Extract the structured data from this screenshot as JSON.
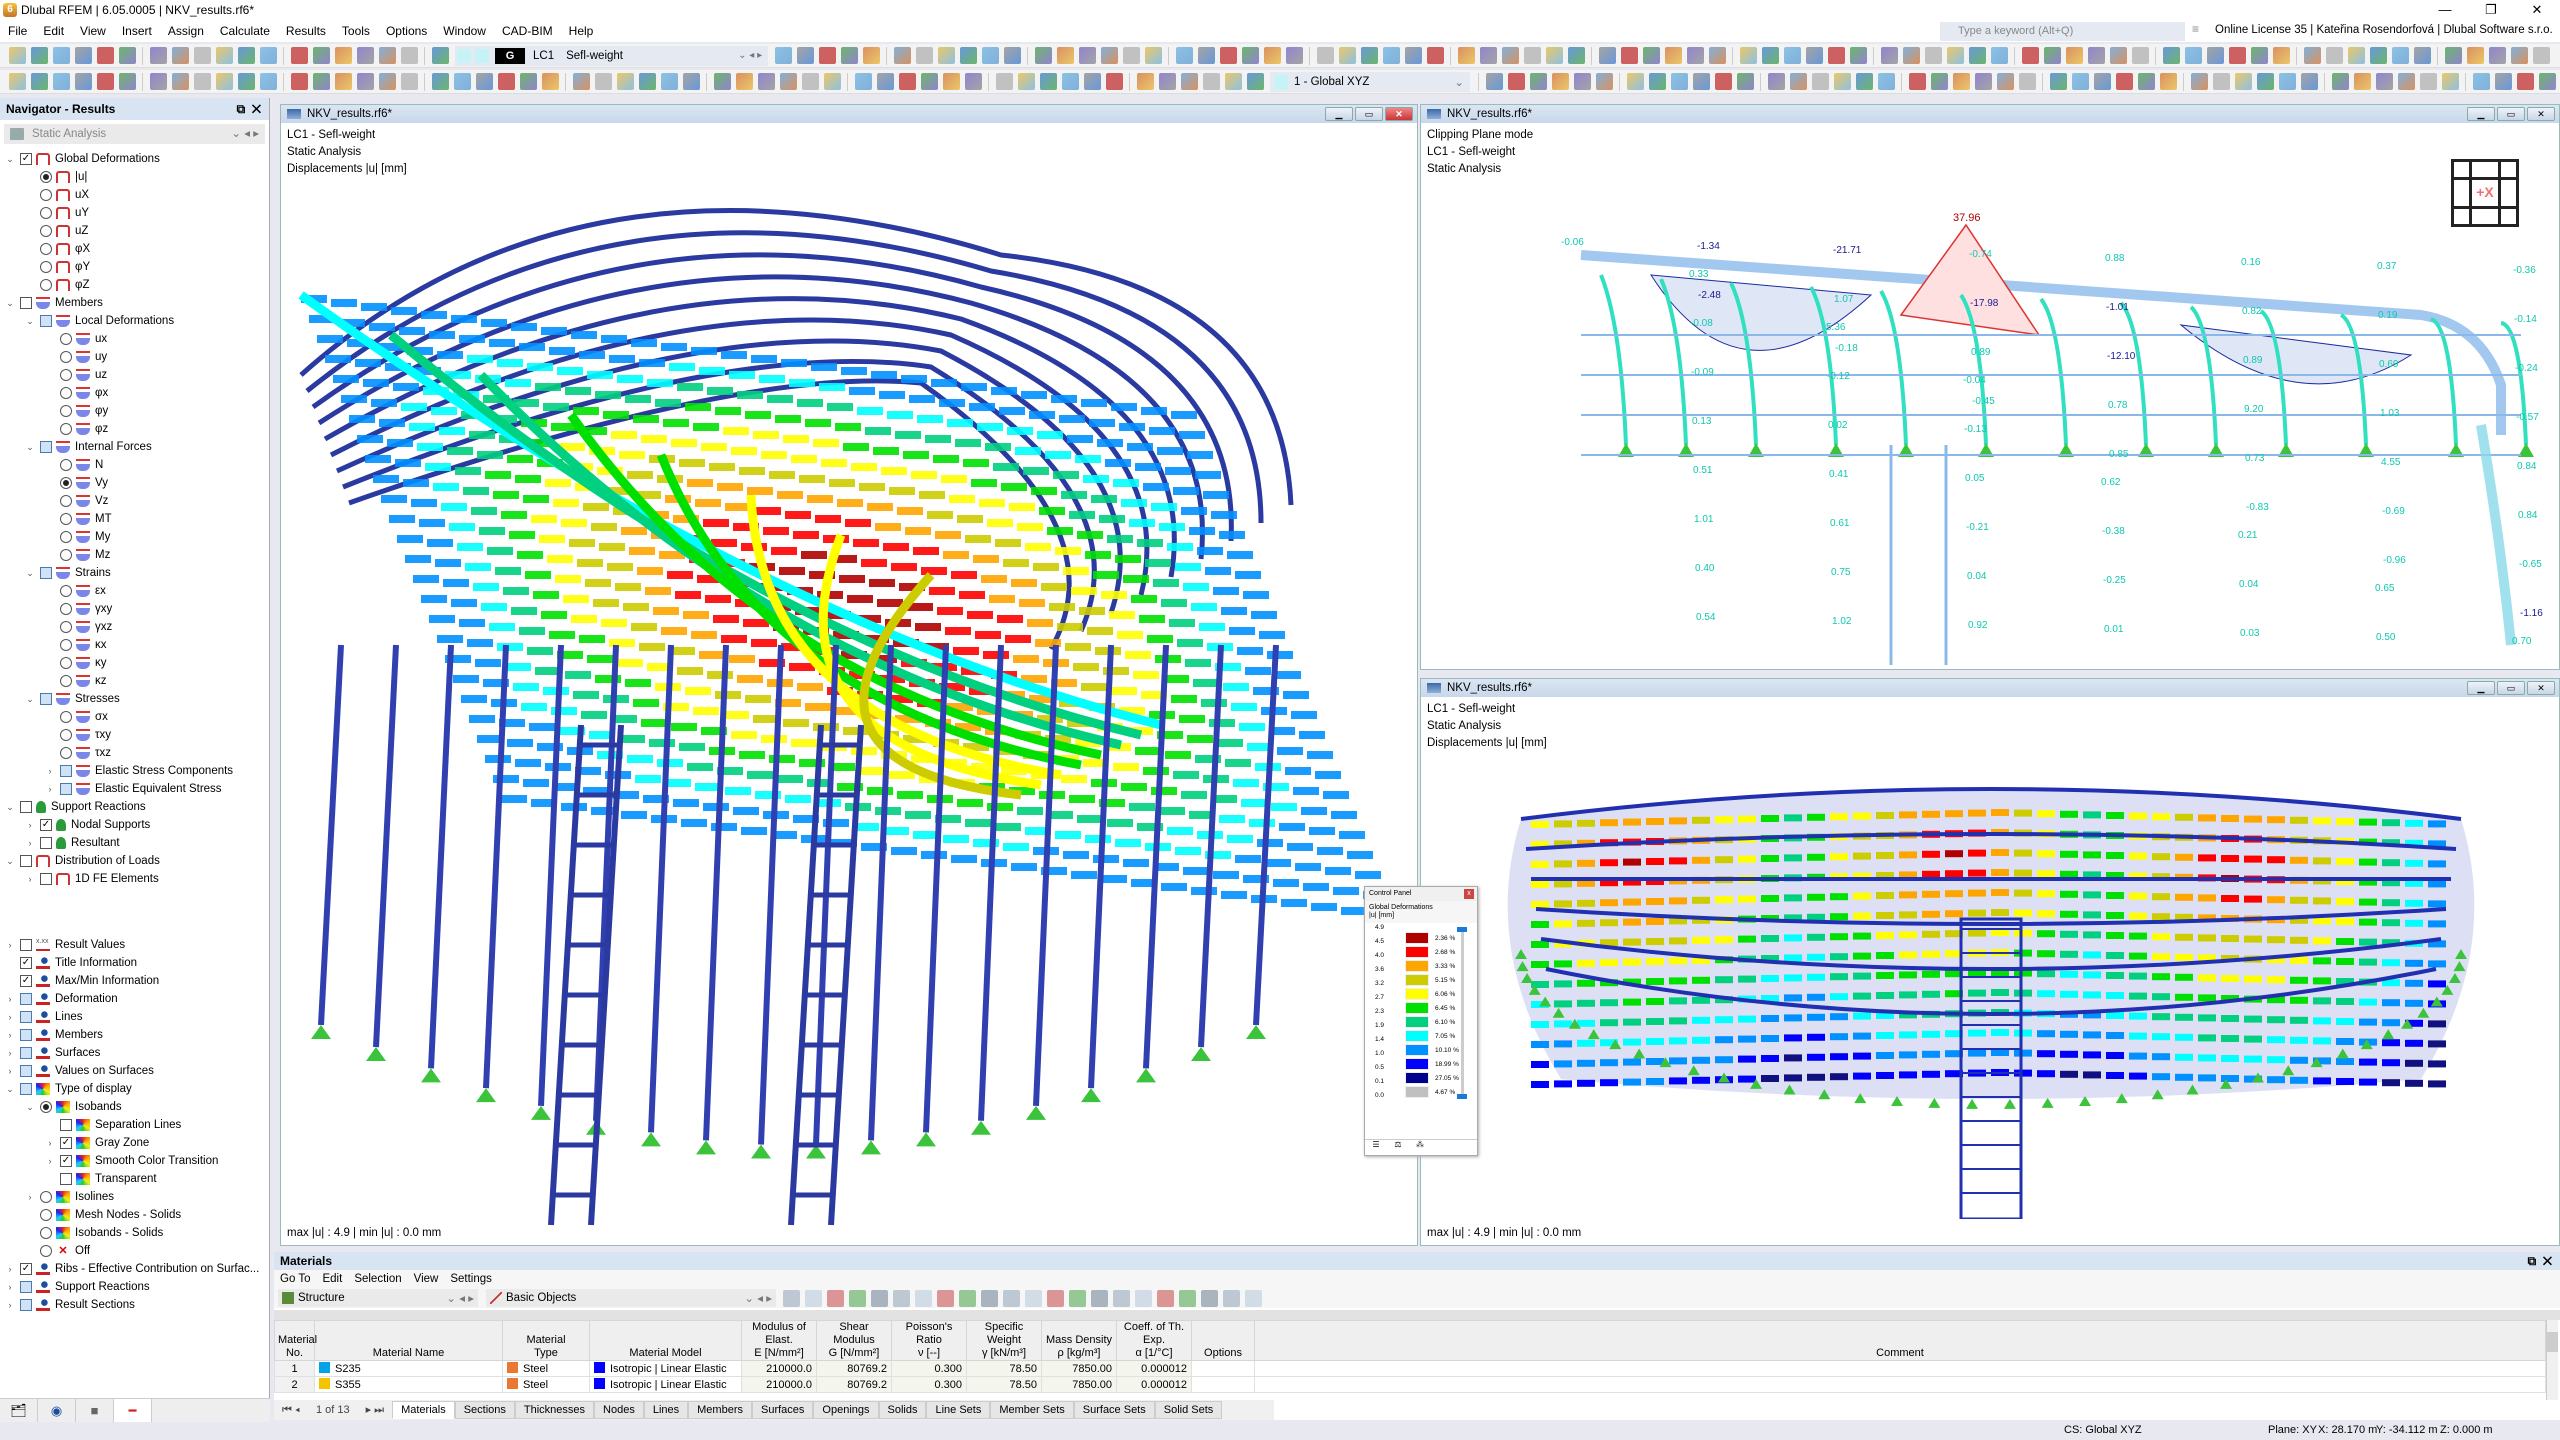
{
  "app": {
    "title": "Dlubal RFEM | 6.05.0005 | NKV_results.rf6*"
  },
  "menu": [
    "File",
    "Edit",
    "View",
    "Insert",
    "Assign",
    "Calculate",
    "Results",
    "Tools",
    "Options",
    "Window",
    "CAD-BIM",
    "Help"
  ],
  "search": {
    "placeholder": "Type a keyword (Alt+Q)"
  },
  "license": "Online License 35 | Kateřina Rosendorfová | Dlubal Software s.r.o.",
  "toolbar": {
    "loadcase_badge": "G",
    "loadcase_id": "LC1",
    "loadcase_name": "Sefl-weight",
    "coord_system": "1 - Global XYZ"
  },
  "navigator": {
    "title": "Navigator - Results",
    "analysis": "Static Analysis",
    "items": [
      {
        "label": "Global Deformations",
        "level": 0,
        "type": "cb",
        "state": "checked",
        "icon": "gd",
        "exp": "open"
      },
      {
        "label": "|u|",
        "level": 1,
        "type": "rd",
        "state": "on",
        "icon": "gd"
      },
      {
        "label": "uX",
        "level": 1,
        "type": "rd",
        "state": "off",
        "icon": "gd"
      },
      {
        "label": "uY",
        "level": 1,
        "type": "rd",
        "state": "off",
        "icon": "gd"
      },
      {
        "label": "uZ",
        "level": 1,
        "type": "rd",
        "state": "off",
        "icon": "gd"
      },
      {
        "label": "φX",
        "level": 1,
        "type": "rd",
        "state": "off",
        "icon": "gd"
      },
      {
        "label": "φY",
        "level": 1,
        "type": "rd",
        "state": "off",
        "icon": "gd"
      },
      {
        "label": "φZ",
        "level": 1,
        "type": "rd",
        "state": "off",
        "icon": "gd"
      },
      {
        "label": "Members",
        "level": 0,
        "type": "cb",
        "state": "unchecked",
        "icon": "mb",
        "exp": "open"
      },
      {
        "label": "Local Deformations",
        "level": 1,
        "type": "cb",
        "state": "partial",
        "icon": "mb",
        "exp": "open"
      },
      {
        "label": "ux",
        "level": 2,
        "type": "rd",
        "state": "off",
        "icon": "mb"
      },
      {
        "label": "uy",
        "level": 2,
        "type": "rd",
        "state": "off",
        "icon": "mb"
      },
      {
        "label": "uz",
        "level": 2,
        "type": "rd",
        "state": "off",
        "icon": "mb"
      },
      {
        "label": "φx",
        "level": 2,
        "type": "rd",
        "state": "off",
        "icon": "mb"
      },
      {
        "label": "φy",
        "level": 2,
        "type": "rd",
        "state": "off",
        "icon": "mb"
      },
      {
        "label": "φz",
        "level": 2,
        "type": "rd",
        "state": "off",
        "icon": "mb"
      },
      {
        "label": "Internal Forces",
        "level": 1,
        "type": "cb",
        "state": "partial",
        "icon": "mb",
        "exp": "open"
      },
      {
        "label": "N",
        "level": 2,
        "type": "rd",
        "state": "off",
        "icon": "mb"
      },
      {
        "label": "Vy",
        "level": 2,
        "type": "rd",
        "state": "on",
        "icon": "mb"
      },
      {
        "label": "Vz",
        "level": 2,
        "type": "rd",
        "state": "off",
        "icon": "mb"
      },
      {
        "label": "MT",
        "level": 2,
        "type": "rd",
        "state": "off",
        "icon": "mb"
      },
      {
        "label": "My",
        "level": 2,
        "type": "rd",
        "state": "off",
        "icon": "mb"
      },
      {
        "label": "Mz",
        "level": 2,
        "type": "rd",
        "state": "off",
        "icon": "mb"
      },
      {
        "label": "Strains",
        "level": 1,
        "type": "cb",
        "state": "partial",
        "icon": "mb",
        "exp": "open"
      },
      {
        "label": "εx",
        "level": 2,
        "type": "rd",
        "state": "off",
        "icon": "mb"
      },
      {
        "label": "γxy",
        "level": 2,
        "type": "rd",
        "state": "off",
        "icon": "mb"
      },
      {
        "label": "γxz",
        "level": 2,
        "type": "rd",
        "state": "off",
        "icon": "mb"
      },
      {
        "label": "κx",
        "level": 2,
        "type": "rd",
        "state": "off",
        "icon": "mb"
      },
      {
        "label": "κy",
        "level": 2,
        "type": "rd",
        "state": "off",
        "icon": "mb"
      },
      {
        "label": "κz",
        "level": 2,
        "type": "rd",
        "state": "off",
        "icon": "mb"
      },
      {
        "label": "Stresses",
        "level": 1,
        "type": "cb",
        "state": "partial",
        "icon": "mb",
        "exp": "open"
      },
      {
        "label": "σx",
        "level": 2,
        "type": "rd",
        "state": "off",
        "icon": "mb"
      },
      {
        "label": "τxy",
        "level": 2,
        "type": "rd",
        "state": "off",
        "icon": "mb"
      },
      {
        "label": "τxz",
        "level": 2,
        "type": "rd",
        "state": "off",
        "icon": "mb"
      },
      {
        "label": "Elastic Stress Components",
        "level": 2,
        "type": "cb",
        "state": "partial",
        "icon": "mb",
        "exp": "closed"
      },
      {
        "label": "Elastic Equivalent Stress",
        "level": 2,
        "type": "cb",
        "state": "partial",
        "icon": "mb",
        "exp": "closed"
      },
      {
        "label": "Support Reactions",
        "level": 0,
        "type": "cb",
        "state": "unchecked",
        "icon": "sr",
        "exp": "open"
      },
      {
        "label": "Nodal Supports",
        "level": 1,
        "type": "cb",
        "state": "checked",
        "icon": "sr",
        "exp": "closed"
      },
      {
        "label": "Resultant",
        "level": 1,
        "type": "cb",
        "state": "unchecked",
        "icon": "sr",
        "exp": "closed"
      },
      {
        "label": "Distribution of Loads",
        "level": 0,
        "type": "cb",
        "state": "unchecked",
        "icon": "gd",
        "exp": "open"
      },
      {
        "label": "1D FE Elements",
        "level": 1,
        "type": "cb",
        "state": "unchecked",
        "icon": "gd",
        "exp": "closed"
      }
    ],
    "display_items": [
      {
        "label": "Result Values",
        "level": 0,
        "type": "cb",
        "state": "unchecked",
        "icon": "rv",
        "exp": "closed"
      },
      {
        "label": "Title Information",
        "level": 0,
        "type": "cb",
        "state": "checked",
        "icon": "ey"
      },
      {
        "label": "Max/Min Information",
        "level": 0,
        "type": "cb",
        "state": "checked",
        "icon": "ey"
      },
      {
        "label": "Deformation",
        "level": 0,
        "type": "cb",
        "state": "partial",
        "icon": "ey",
        "exp": "closed"
      },
      {
        "label": "Lines",
        "level": 0,
        "type": "cb",
        "state": "partial",
        "icon": "ey",
        "exp": "closed"
      },
      {
        "label": "Members",
        "level": 0,
        "type": "cb",
        "state": "partial",
        "icon": "ey",
        "exp": "closed"
      },
      {
        "label": "Surfaces",
        "level": 0,
        "type": "cb",
        "state": "partial",
        "icon": "ey",
        "exp": "closed"
      },
      {
        "label": "Values on Surfaces",
        "level": 0,
        "type": "cb",
        "state": "partial",
        "icon": "ey",
        "exp": "closed"
      },
      {
        "label": "Type of display",
        "level": 0,
        "type": "cb",
        "state": "partial",
        "icon": "iso",
        "exp": "open"
      },
      {
        "label": "Isobands",
        "level": 1,
        "type": "rd",
        "state": "on",
        "icon": "iso",
        "exp": "open"
      },
      {
        "label": "Separation Lines",
        "level": 2,
        "type": "cb",
        "state": "unchecked",
        "icon": "iso"
      },
      {
        "label": "Gray Zone",
        "level": 2,
        "type": "cb",
        "state": "checked",
        "icon": "iso",
        "exp": "closed"
      },
      {
        "label": "Smooth Color Transition",
        "level": 2,
        "type": "cb",
        "state": "checked",
        "icon": "iso",
        "exp": "closed"
      },
      {
        "label": "Transparent",
        "level": 2,
        "type": "cb",
        "state": "unchecked",
        "icon": "iso"
      },
      {
        "label": "Isolines",
        "level": 1,
        "type": "rd",
        "state": "off",
        "icon": "iso",
        "exp": "closed"
      },
      {
        "label": "Mesh Nodes - Solids",
        "level": 1,
        "type": "rd",
        "state": "off",
        "icon": "iso"
      },
      {
        "label": "Isobands - Solids",
        "level": 1,
        "type": "rd",
        "state": "off",
        "icon": "iso"
      },
      {
        "label": "Off",
        "level": 1,
        "type": "rd",
        "state": "off",
        "icon": "off"
      },
      {
        "label": "Ribs - Effective Contribution on Surfac...",
        "level": 0,
        "type": "cb",
        "state": "checked",
        "icon": "ey",
        "exp": "closed"
      },
      {
        "label": "Support Reactions",
        "level": 0,
        "type": "cb",
        "state": "partial",
        "icon": "ey",
        "exp": "closed"
      },
      {
        "label": "Result Sections",
        "level": 0,
        "type": "cb",
        "state": "partial",
        "icon": "ey",
        "exp": "closed"
      }
    ]
  },
  "viewports": {
    "main": {
      "title": "NKV_results.rf6*",
      "lines": [
        "LC1 - Sefl-weight",
        "Static Analysis",
        "Displacements |u| [mm]"
      ],
      "maxmin": "max |u| : 4.9 | min |u| : 0.0 mm"
    },
    "top_right": {
      "title": "NKV_results.rf6*",
      "lines": [
        "Clipping Plane mode",
        "LC1 - Sefl-weight",
        "Static Analysis"
      ],
      "peak_value": "37.96",
      "view_cube_label": "+X",
      "labels": [
        "-0.06",
        "-2.48",
        "-0.18",
        "-0.45",
        "0.85",
        "-0.83",
        "-0.96",
        "-1.16",
        "-1.34",
        "1.07",
        "0.89",
        "0.78",
        "0.73",
        "-0.69",
        "-0.65",
        "0.54",
        "-21.71",
        "-17.98",
        "-12.10",
        "9.20",
        "4.55",
        "0.84",
        "0.40",
        "1.02",
        "-0.74",
        "-1.01",
        "0.89",
        "1.03",
        "0.84",
        "1.01",
        "0.75",
        "0.92",
        "0.88",
        "0.82",
        "0.69",
        "-0.57",
        "0.51",
        "0.61",
        "0.04",
        "0.01",
        "0.16",
        "0.19",
        "-0.24",
        "0.13",
        "0.41",
        "-0.21",
        "-0.25",
        "0.03",
        "0.37",
        "-0.14",
        "-0.09",
        "0.02",
        "0.05",
        "-0.38",
        "0.04",
        "0.50",
        "-0.36",
        "-0.08",
        "-0.12",
        "-0.13",
        "0.62",
        "0.21",
        "0.65",
        "0.70",
        "0.33",
        "5.36",
        "-0.04"
      ]
    },
    "bottom_right": {
      "title": "NKV_results.rf6*",
      "lines": [
        "LC1 - Sefl-weight",
        "Static Analysis",
        "Displacements |u| [mm]"
      ],
      "maxmin": "max |u| : 4.9 | min |u| : 0.0 mm"
    }
  },
  "control_panel": {
    "title": "Control Panel",
    "subtitle": "Global Deformations",
    "unit": "|u| [mm]",
    "values": [
      "4.9",
      "4.5",
      "4.0",
      "3.6",
      "3.2",
      "2.7",
      "2.3",
      "1.9",
      "1.4",
      "1.0",
      "0.5",
      "0.1",
      "0.0"
    ],
    "bands": [
      {
        "color": "#b00000",
        "pct": "2.36 %"
      },
      {
        "color": "#ff0000",
        "pct": "2.68 %"
      },
      {
        "color": "#ffa500",
        "pct": "3.33 %"
      },
      {
        "color": "#cccc00",
        "pct": "5.15 %"
      },
      {
        "color": "#ffff00",
        "pct": "6.06 %"
      },
      {
        "color": "#00e000",
        "pct": "6.45 %"
      },
      {
        "color": "#00d080",
        "pct": "6.10 %"
      },
      {
        "color": "#00ffff",
        "pct": "7.05 %"
      },
      {
        "color": "#0090ff",
        "pct": "10.10 %"
      },
      {
        "color": "#0000ff",
        "pct": "18.99 %"
      },
      {
        "color": "#000090",
        "pct": "27.05 %"
      },
      {
        "color": "#c0c0c0",
        "pct": "4.67 %"
      }
    ]
  },
  "materials_panel": {
    "title": "Materials",
    "menu": [
      "Go To",
      "Edit",
      "Selection",
      "View",
      "Settings"
    ],
    "filter1": "Structure",
    "filter2": "Basic Objects",
    "headers": [
      [
        "Material",
        "No."
      ],
      [
        "",
        "Material Name"
      ],
      [
        "Material",
        "Type"
      ],
      [
        "",
        "Material Model"
      ],
      [
        "Modulus of Elast.",
        "E [N/mm²]"
      ],
      [
        "Shear Modulus",
        "G [N/mm²]"
      ],
      [
        "Poisson's Ratio",
        "ν [--]"
      ],
      [
        "Specific Weight",
        "γ [kN/m³]"
      ],
      [
        "Mass Density",
        "ρ [kg/m³]"
      ],
      [
        "Coeff. of Th. Exp.",
        "α [1/°C]"
      ],
      [
        "",
        "Options"
      ],
      [
        "",
        "Comment"
      ]
    ],
    "rows": [
      {
        "no": "1",
        "name": "S235",
        "name_color": "#00a2e8",
        "type": "Steel",
        "type_color": "#e87833",
        "model": "Isotropic | Linear Elastic",
        "model_color": "#0000ff",
        "E": "210000.0",
        "G": "80769.2",
        "nu": "0.300",
        "gamma": "78.50",
        "rho": "7850.00",
        "alpha": "0.000012",
        "options": "",
        "comment": ""
      },
      {
        "no": "2",
        "name": "S355",
        "name_color": "#f5c400",
        "type": "Steel",
        "type_color": "#e87833",
        "model": "Isotropic | Linear Elastic",
        "model_color": "#0000ff",
        "E": "210000.0",
        "G": "80769.2",
        "nu": "0.300",
        "gamma": "78.50",
        "rho": "7850.00",
        "alpha": "0.000012",
        "options": "",
        "comment": ""
      }
    ],
    "pager": "1 of 13",
    "tabs": [
      "Materials",
      "Sections",
      "Thicknesses",
      "Nodes",
      "Lines",
      "Members",
      "Surfaces",
      "Openings",
      "Solids",
      "Line Sets",
      "Member Sets",
      "Surface Sets",
      "Solid Sets"
    ],
    "active_tab": "Materials"
  },
  "status": {
    "cs": "CS: Global XYZ",
    "plane": "Plane: XY",
    "x": "X: 28.170 m",
    "y": "Y: -34.112 m",
    "z": "Z: 0.000 m"
  }
}
